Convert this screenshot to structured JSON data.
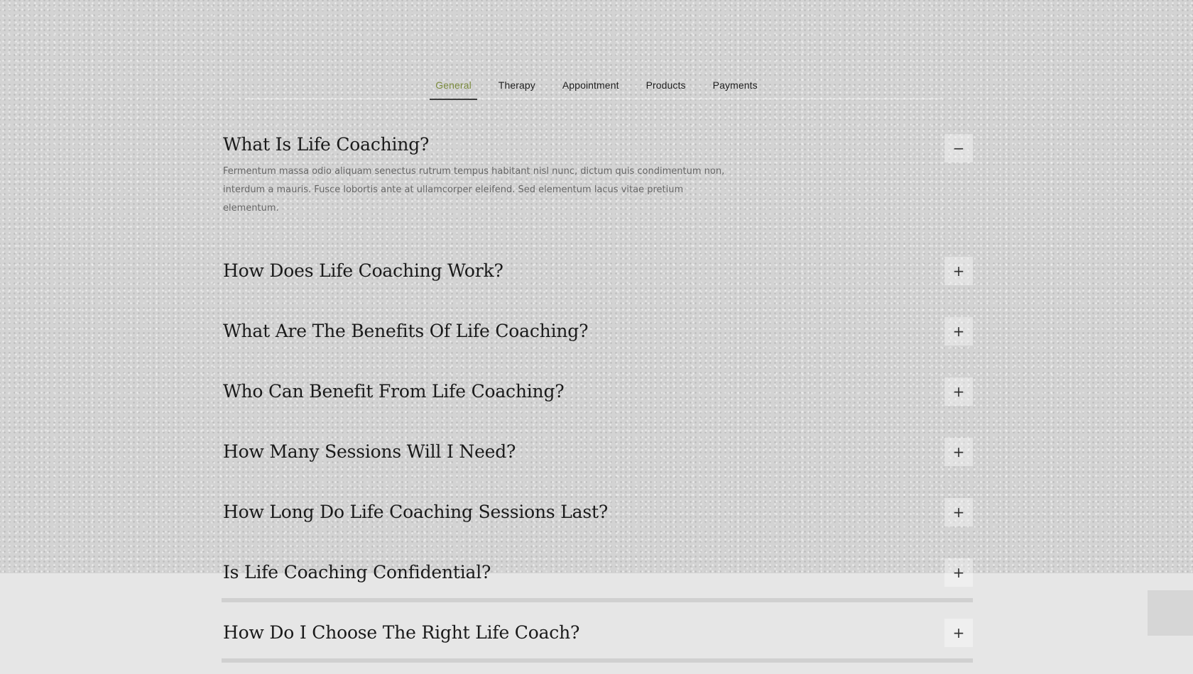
{
  "tabs": [
    {
      "label": "General",
      "active": true
    },
    {
      "label": "Therapy",
      "active": false
    },
    {
      "label": "Appointment",
      "active": false
    },
    {
      "label": "Products",
      "active": false
    },
    {
      "label": "Payments",
      "active": false
    }
  ],
  "faq": {
    "items": [
      {
        "question": "What Is Life Coaching?",
        "expanded": true,
        "toggle_icon": "−",
        "answer": "Fermentum massa odio aliquam senectus rutrum tempus habitant nisl nunc, dictum quis condimentum non, interdum a mauris. Fusce lobortis ante at ullamcorper eleifend. Sed elementum lacus vitae pretium elementum."
      },
      {
        "question": "How Does Life Coaching Work?",
        "expanded": false,
        "toggle_icon": "+"
      },
      {
        "question": "What Are The Benefits Of Life Coaching?",
        "expanded": false,
        "toggle_icon": "+"
      },
      {
        "question": "Who Can Benefit From Life Coaching?",
        "expanded": false,
        "toggle_icon": "+"
      },
      {
        "question": "How Many Sessions Will I Need?",
        "expanded": false,
        "toggle_icon": "+"
      },
      {
        "question": "How Long Do Life Coaching Sessions Last?",
        "expanded": false,
        "toggle_icon": "+"
      },
      {
        "question": "Is Life Coaching Confidential?",
        "expanded": false,
        "toggle_icon": "+"
      },
      {
        "question": "How Do I Choose The Right Life Coach?",
        "expanded": false,
        "toggle_icon": "+"
      }
    ]
  },
  "colors": {
    "active_tab": "#7b8b3e",
    "heading": "#1a1a1a",
    "body_text": "#666666"
  }
}
